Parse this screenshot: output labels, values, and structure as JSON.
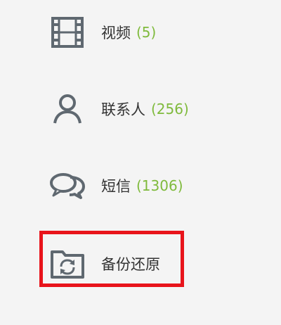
{
  "sidebar": {
    "items": [
      {
        "id": "video",
        "label": "视频",
        "count": "(5)",
        "icon": "film-icon"
      },
      {
        "id": "contacts",
        "label": "联系人",
        "count": "(256)",
        "icon": "person-icon"
      },
      {
        "id": "sms",
        "label": "短信",
        "count": "(1306)",
        "icon": "chat-bubbles-icon"
      },
      {
        "id": "backup",
        "label": "备份还原",
        "count": "",
        "icon": "backup-folder-icon"
      }
    ]
  },
  "colors": {
    "background": "#f4f4f4",
    "label_text": "#333333",
    "count_text": "#7fba3c",
    "icon_gray": "#5f6870",
    "highlight_border": "#e8141b"
  }
}
